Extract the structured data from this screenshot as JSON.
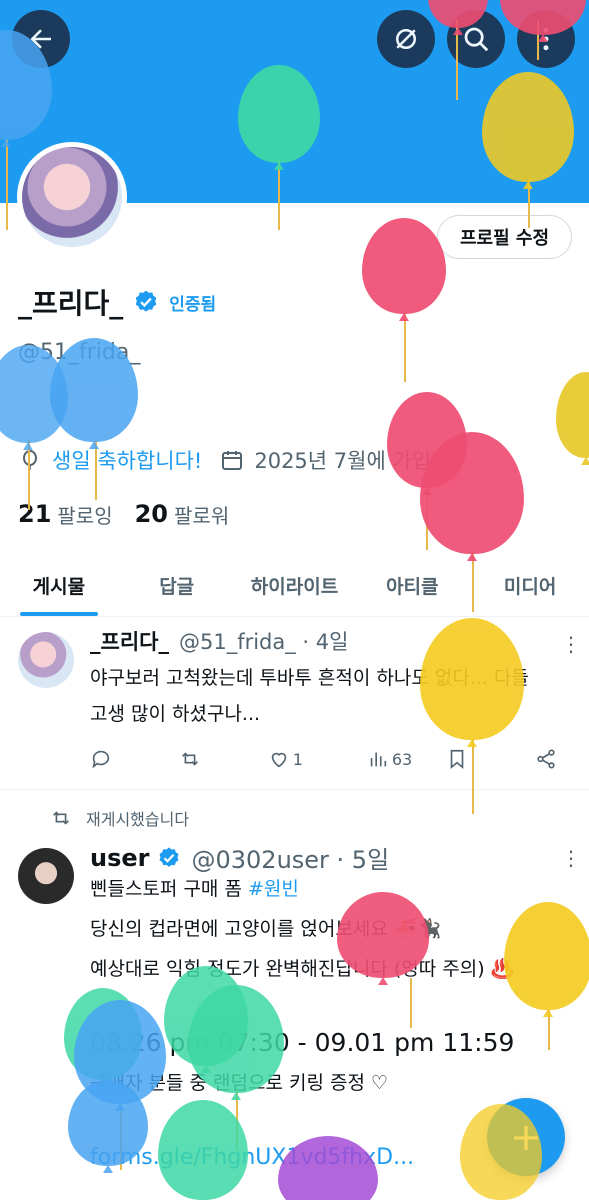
{
  "header": {
    "back_icon": "arrow-left-icon",
    "hide_icon": "eye-slash-icon",
    "search_icon": "search-icon",
    "more_icon": "vertical-dots-icon"
  },
  "profile": {
    "edit_button": "프로필 수정",
    "name": "_프리다_",
    "verified_label": "인증됨",
    "handle": "@51_frida_",
    "birthday": "생일 축하합니다!",
    "joined": "2025년 7월에 가입함",
    "following_count": "21",
    "following_label": "팔로잉",
    "followers_count": "20",
    "followers_label": "팔로워"
  },
  "tabs": [
    {
      "label": "게시물",
      "active": true
    },
    {
      "label": "답글",
      "active": false
    },
    {
      "label": "하이라이트",
      "active": false
    },
    {
      "label": "아티클",
      "active": false
    },
    {
      "label": "미디어",
      "active": false
    }
  ],
  "posts": [
    {
      "name": "_프리다_",
      "handle": "@51_frida_ · 4일",
      "text": "야구보러 고척왔는데 투바투 흔적이 하나도 없다... 다들 고생 많이 하셨구나...",
      "likes": "1",
      "views": "63"
    },
    {
      "repost_note": "재게시했습니다",
      "name": "user",
      "handle": "@0302user · 5일",
      "line1": "삔들스토퍼 구매 폼 ",
      "hashtag": "#원빈",
      "line2": "당신의 컵라면에 고양이를 얹어보세요 🍜🐈‍⬛",
      " line3": "",
      "line3": " 예상대로 익힘 정도가 완벽해진답니다 (엉따 주의) ♨️",
      "line4": "08.26 pm 07:30 - 09.01 pm 11:59",
      "line5": "구매자 분들 중 랜덤으로 키링 증정 ♡",
      "link": "forms.gle/FhgnUX1vd5fhxD..."
    }
  ],
  "fab_label": "+"
}
